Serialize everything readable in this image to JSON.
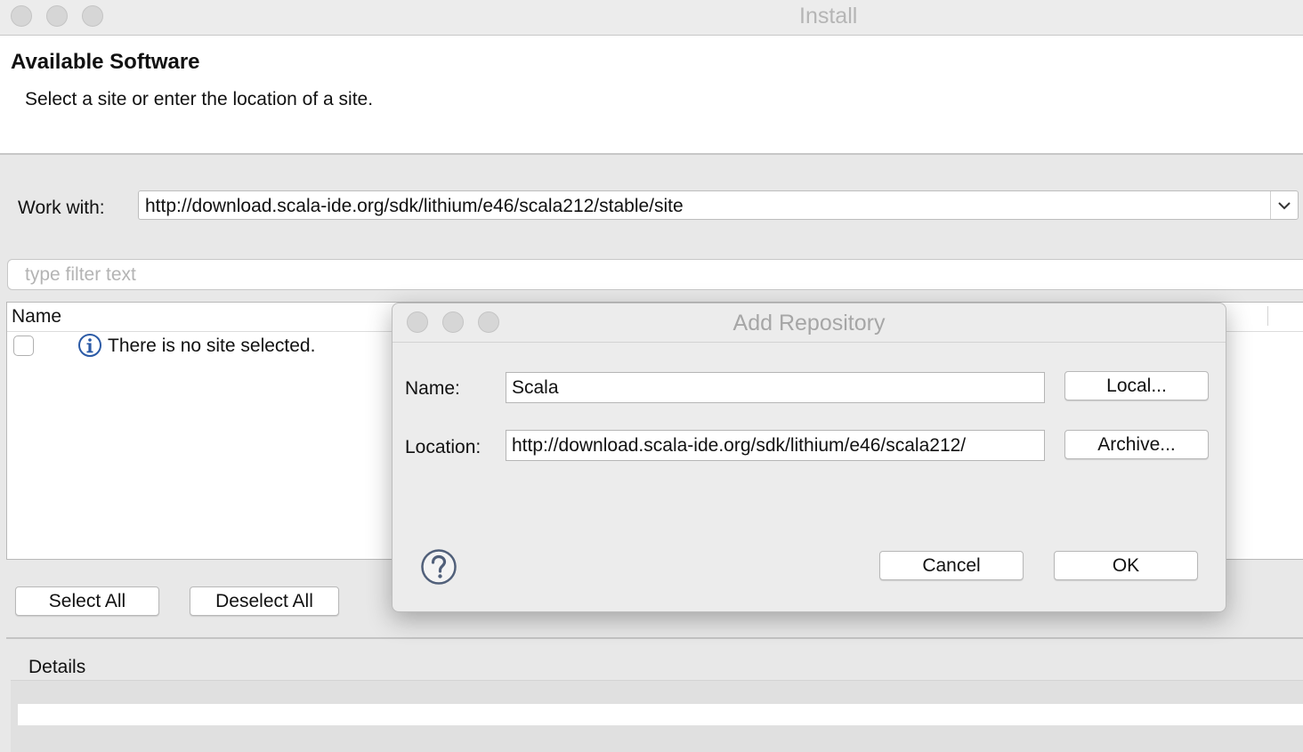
{
  "window": {
    "title": "Install"
  },
  "header": {
    "title": "Available Software",
    "subtitle": "Select a site or enter the location of a site."
  },
  "work_with": {
    "label": "Work with:",
    "value": "http://download.scala-ide.org/sdk/lithium/e46/scala212/stable/site",
    "arrow": "⌄"
  },
  "filter": {
    "placeholder": "type filter text"
  },
  "tree": {
    "column_name": "Name",
    "message": "There is no site selected.",
    "info_icon": "info-icon"
  },
  "buttons": {
    "select_all": "Select All",
    "deselect_all": "Deselect All"
  },
  "details": {
    "label": "Details"
  },
  "dialog": {
    "title": "Add Repository",
    "name_label": "Name:",
    "name_value": "Scala",
    "location_label": "Location:",
    "location_value": "http://download.scala-ide.org/sdk/lithium/e46/scala212/",
    "local_button": "Local...",
    "archive_button": "Archive...",
    "cancel_button": "Cancel",
    "ok_button": "OK",
    "help_icon": "help-icon"
  }
}
